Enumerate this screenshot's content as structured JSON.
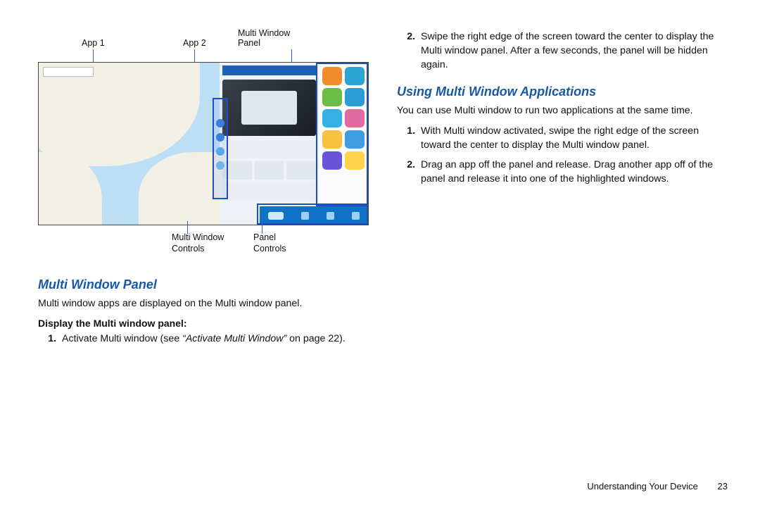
{
  "diagram_labels": {
    "app1": "App 1",
    "app2": "App 2",
    "mw_panel_l1": "Multi Window",
    "mw_panel_l2": "Panel",
    "mw_controls_l1": "Multi Window",
    "mw_controls_l2": "Controls",
    "panel_controls_l1": "Panel",
    "panel_controls_l2": "Controls"
  },
  "left": {
    "heading1": "Multi Window Panel",
    "intro": "Multi window apps are displayed on the Multi window panel.",
    "subhead": "Display the Multi window panel:",
    "step1_pre": "Activate Multi window (see ",
    "step1_em": "“Activate Multi Window”",
    "step1_post": " on page 22)."
  },
  "right": {
    "step2": "Swipe the right edge of the screen toward the center to display the Multi window panel. After a few seconds, the panel will be hidden again.",
    "heading2": "Using Multi Window Applications",
    "intro2": "You can use Multi window to run two applications at the same time.",
    "ustep1": "With Multi window activated, swipe the right edge of the screen toward the center to display the Multi window panel.",
    "ustep2": "Drag an app off the panel and release. Drag another app off of the panel and release it into one of the highlighted windows."
  },
  "footer": {
    "section": "Understanding Your Device",
    "page": "23"
  }
}
